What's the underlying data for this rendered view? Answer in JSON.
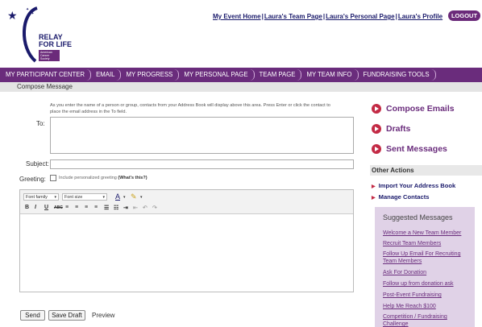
{
  "brand": {
    "logo_text_line1": "RELAY",
    "logo_text_line2": "FOR LIFE",
    "badge_text": "American Cancer Society"
  },
  "top_links": [
    "My Event Home",
    "Laura's Team Page",
    "Laura's Personal Page",
    "Laura's Profile"
  ],
  "logout_label": "LOGOUT",
  "nav": [
    "MY PARTICIPANT CENTER",
    "EMAIL",
    "MY PROGRESS",
    "MY PERSONAL PAGE",
    "TEAM PAGE",
    "MY TEAM INFO",
    "FUNDRAISING TOOLS"
  ],
  "compose": {
    "title": "Compose Message",
    "instructions": "As you enter the name of a person or group, contacts from your Address Book will display above this area. Press Enter or click the contact to place the email address in the To field.",
    "to_label": "To:",
    "subject_label": "Subject:",
    "greeting_label": "Greeting:",
    "greeting_option": "Include personalized greeting",
    "greeting_help": "(What's this?)",
    "font_family": "Font family",
    "font_size": "Font size"
  },
  "actions": {
    "send": "Send",
    "save_draft": "Save Draft",
    "preview": "Preview"
  },
  "right_panel": {
    "compose_emails": "Compose Emails",
    "drafts": "Drafts",
    "sent_messages": "Sent Messages",
    "other_actions_title": "Other Actions",
    "import_address_book": "Import Your Address Book",
    "manage_contacts": "Manage Contacts",
    "suggested_title": "Suggested Messages",
    "suggested": [
      "Welcome a New Team Member",
      "Recruit Team Members",
      "Follow Up Email For Recruiting Team Members",
      "Ask For Donation",
      "Follow up from donation ask",
      "Post-Event Fundraising",
      "Help Me Reach $100",
      "Competition / Fundraising Challenge"
    ]
  },
  "colors": {
    "brand_purple": "#6a2c7c",
    "accent_red": "#c32a45",
    "link_navy": "#1a1a6b",
    "suggested_bg": "#e0d2e7"
  }
}
